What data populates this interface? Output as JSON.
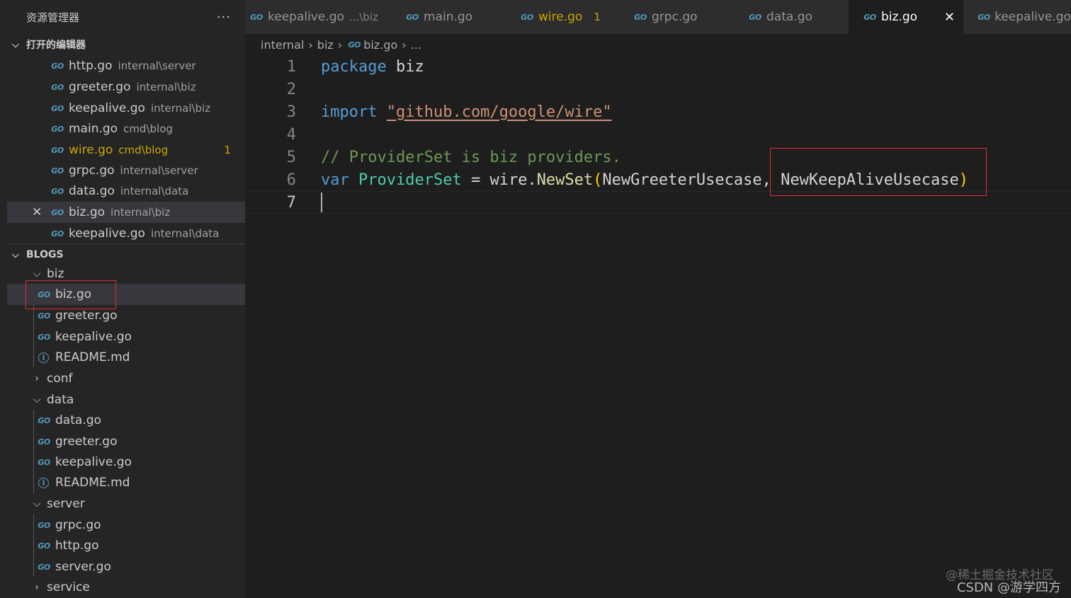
{
  "sidebar": {
    "title": "资源管理器",
    "more": "···",
    "open_editors": {
      "heading": "打开的编辑器",
      "items": [
        {
          "name": "http.go",
          "desc": "internal\\server"
        },
        {
          "name": "greeter.go",
          "desc": "internal\\biz"
        },
        {
          "name": "keepalive.go",
          "desc": "internal\\biz"
        },
        {
          "name": "main.go",
          "desc": "cmd\\blog"
        },
        {
          "name": "wire.go",
          "desc": "cmd\\blog",
          "badge": "1"
        },
        {
          "name": "grpc.go",
          "desc": "internal\\server"
        },
        {
          "name": "data.go",
          "desc": "internal\\data"
        },
        {
          "name": "biz.go",
          "desc": "internal\\biz",
          "close": "✕"
        },
        {
          "name": "keepalive.go",
          "desc": "internal\\data"
        }
      ]
    },
    "project": {
      "heading": "BLOGS",
      "folders": {
        "biz": "biz",
        "conf": "conf",
        "data": "data",
        "server": "server",
        "service": "service"
      },
      "biz_files": [
        "biz.go",
        "greeter.go",
        "keepalive.go",
        "README.md"
      ],
      "data_files": [
        "data.go",
        "greeter.go",
        "keepalive.go",
        "README.md"
      ],
      "server_files": [
        "grpc.go",
        "http.go",
        "server.go"
      ]
    }
  },
  "tabs": [
    {
      "label": "keepalive.go",
      "desc": "...\\biz"
    },
    {
      "label": "main.go"
    },
    {
      "label": "wire.go",
      "badge": "1"
    },
    {
      "label": "grpc.go"
    },
    {
      "label": "data.go"
    },
    {
      "label": "biz.go",
      "close": "✕"
    },
    {
      "label": "keepalive.go"
    }
  ],
  "breadcrumb": {
    "parts": [
      "internal",
      "biz",
      "biz.go",
      "..."
    ],
    "sep": "›"
  },
  "editor": {
    "line_numbers": [
      "1",
      "2",
      "3",
      "4",
      "5",
      "6",
      "7"
    ],
    "line1": {
      "kw": "package",
      "id": "biz"
    },
    "line3": {
      "kw": "import",
      "str": "\"github.com/google/wire\""
    },
    "line5": {
      "comment": "// ProviderSet is biz providers."
    },
    "line6": {
      "kw": "var",
      "name": "ProviderSet",
      "op": " = ",
      "pkg": "wire",
      "dot": ".",
      "fn": "NewSet",
      "open": "(",
      "arg1": "NewGreeterUsecase",
      "comma": ", ",
      "arg2": "NewKeepAliveUsecase",
      "close": ")"
    }
  },
  "icons": {
    "go": "GO",
    "info": "i",
    "chevron_down": "⌵",
    "chevron_right": "›"
  },
  "watermark": {
    "line1": "@稀土掘金技术社区",
    "line2": "CSDN @游学四方"
  },
  "colors": {
    "highlight_box": "#e03030",
    "modified": "#cca700",
    "go_icon": "#519aba"
  }
}
